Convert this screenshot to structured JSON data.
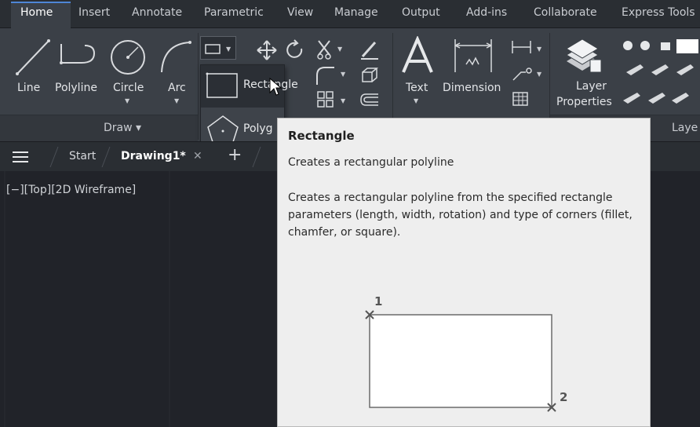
{
  "ribbon_tabs": [
    "Home",
    "Insert",
    "Annotate",
    "Parametric",
    "View",
    "Manage",
    "Output",
    "Add-ins",
    "Collaborate",
    "Express Tools"
  ],
  "active_tab": "Home",
  "draw_panel": {
    "buttons": [
      "Line",
      "Polyline",
      "Circle",
      "Arc"
    ],
    "title": "Draw ▾"
  },
  "annotation_panel": {
    "text_label": "Text",
    "dimension_label": "Dimension"
  },
  "layers_panel": {
    "layer_properties_line1": "Layer",
    "layer_properties_line2": "Properties",
    "title": "Laye"
  },
  "dropdown": {
    "items": [
      "Rectangle",
      "Polyg"
    ]
  },
  "file_tabs": {
    "start": "Start",
    "drawing": "Drawing1*",
    "close": "✕",
    "new": "+"
  },
  "viewport_label": "[−][Top][2D Wireframe]",
  "tooltip": {
    "title": "Rectangle",
    "subtitle": "Creates a rectangular polyline",
    "description": "Creates a rectangular polyline from the specified rectangle parameters (length, width, rotation) and type of corners (fillet, chamfer, or square).",
    "point1": "1",
    "point2": "2"
  },
  "colors": {
    "ribbon_bg": "#3b4047",
    "tabbar_bg": "#2a2e33",
    "viewport_bg": "#212329",
    "tooltip_bg": "#eeeeee",
    "accent": "#4e86d6"
  }
}
